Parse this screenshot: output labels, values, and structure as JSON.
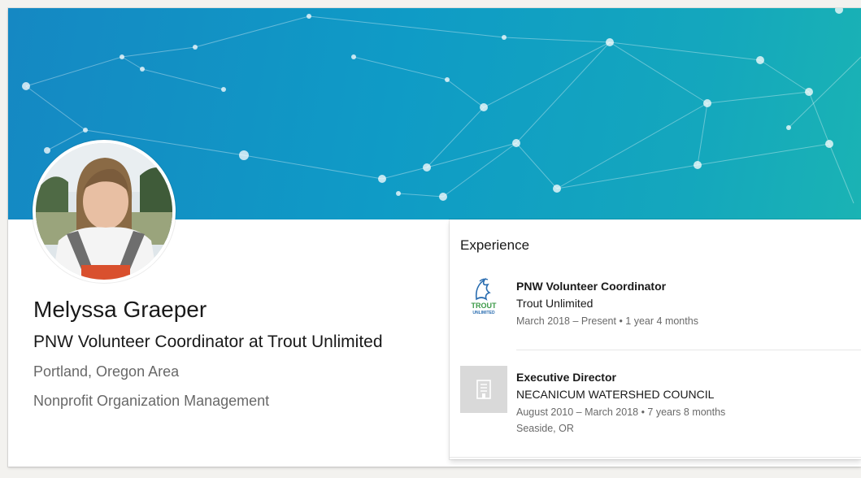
{
  "profile": {
    "name": "Melyssa Graeper",
    "headline": "PNW Volunteer Coordinator at Trout Unlimited",
    "location": "Portland, Oregon Area",
    "industry": "Nonprofit Organization Management"
  },
  "experience": {
    "title": "Experience",
    "items": [
      {
        "role": "PNW Volunteer Coordinator",
        "company": "Trout Unlimited",
        "dates": "March 2018 – Present • 1 year 4 months",
        "logo_text_top": "TROUT",
        "logo_text_bottom": "UNLIMITED"
      },
      {
        "role": "Executive Director",
        "company": "NECANICUM WATERSHED COUNCIL",
        "dates": "August 2010 – March 2018 • 7 years 8 months",
        "location": "Seaside, OR"
      }
    ]
  },
  "colors": {
    "banner_start": "#1588c3",
    "banner_end": "#1ab3b4",
    "trout_blue": "#2a6db0",
    "trout_green": "#3c9a48"
  }
}
